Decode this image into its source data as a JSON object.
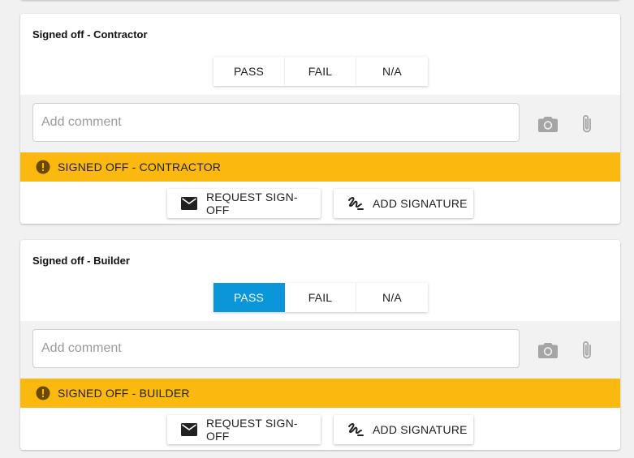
{
  "sections": [
    {
      "title": "Signed off - Contractor",
      "options": [
        "PASS",
        "FAIL",
        "N/A"
      ],
      "selected": "",
      "comment_placeholder": "Add comment",
      "comment_value": "",
      "status_text": "SIGNED OFF - CONTRACTOR",
      "request_label": "REQUEST SIGN-OFF",
      "signature_label": "ADD SIGNATURE"
    },
    {
      "title": "Signed off - Builder",
      "options": [
        "PASS",
        "FAIL",
        "N/A"
      ],
      "selected": "PASS",
      "comment_placeholder": "Add comment",
      "comment_value": "",
      "status_text": "SIGNED OFF - BUILDER",
      "request_label": "REQUEST SIGN-OFF",
      "signature_label": "ADD SIGNATURE"
    }
  ],
  "icons": {
    "camera": "camera-icon",
    "attachment": "paperclip-icon",
    "warning": "exclamation-circle-icon",
    "request": "envelope-icon",
    "signature": "signature-icon"
  },
  "colors": {
    "accent": "#0a96d8",
    "warning": "#fbb80f",
    "background": "#f1f1f1"
  }
}
